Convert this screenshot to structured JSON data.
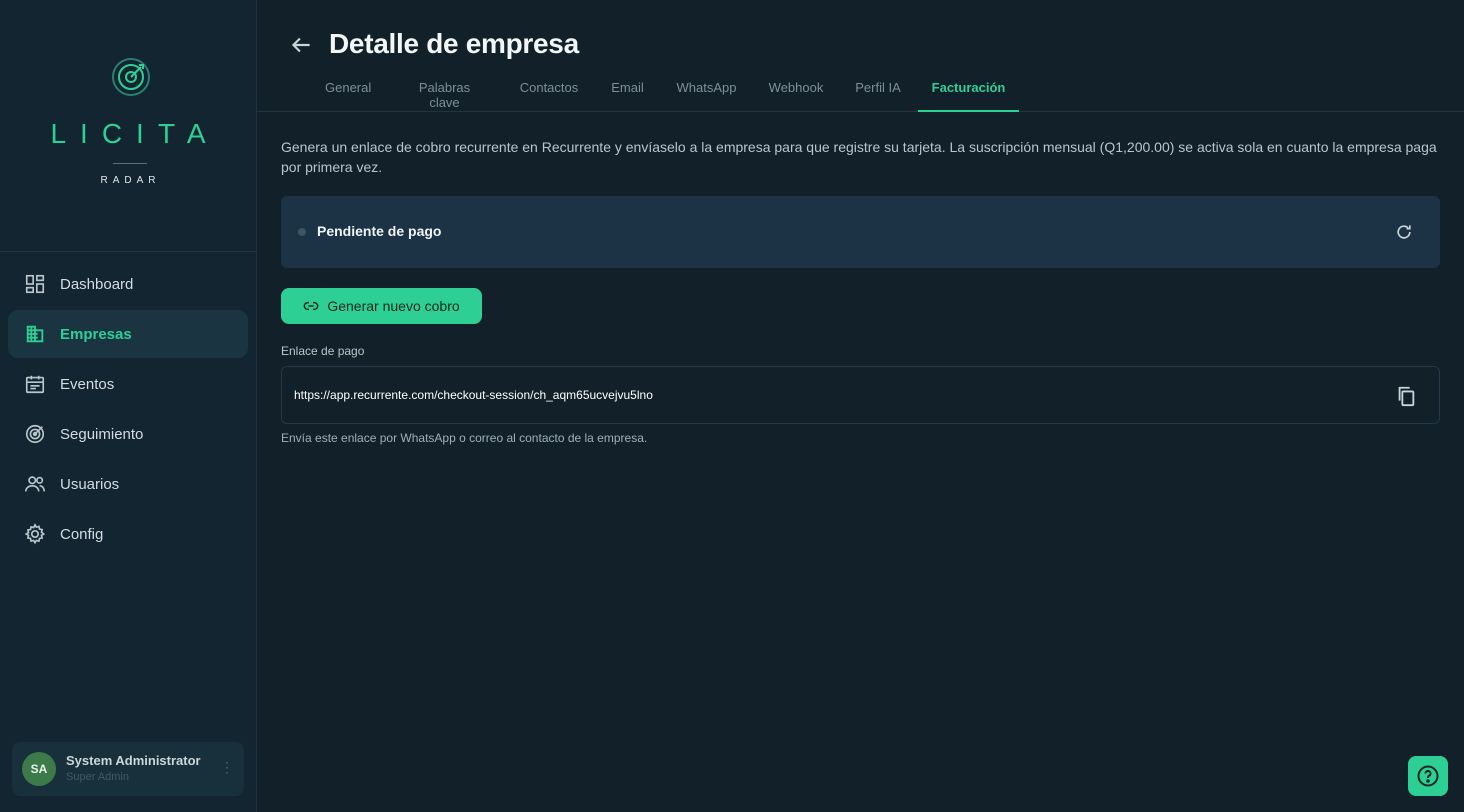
{
  "brand": {
    "name": "LICITA",
    "subtitle": "RADAR",
    "accent": "#2ecf94"
  },
  "sidebar": {
    "items": [
      {
        "label": "Dashboard",
        "icon": "dashboard-icon",
        "active": false
      },
      {
        "label": "Empresas",
        "icon": "building-icon",
        "active": true
      },
      {
        "label": "Eventos",
        "icon": "calendar-icon",
        "active": false
      },
      {
        "label": "Seguimiento",
        "icon": "radar-icon",
        "active": false
      },
      {
        "label": "Usuarios",
        "icon": "users-icon",
        "active": false
      },
      {
        "label": "Config",
        "icon": "gear-icon",
        "active": false
      }
    ],
    "user": {
      "initials": "SA",
      "name": "System Administrator",
      "role": "Super Admin"
    }
  },
  "header": {
    "title": "Detalle de empresa",
    "tabs": [
      {
        "label": "General"
      },
      {
        "label": "Palabras clave"
      },
      {
        "label": "Contactos"
      },
      {
        "label": "Email"
      },
      {
        "label": "WhatsApp"
      },
      {
        "label": "Webhook"
      },
      {
        "label": "Perfil IA"
      },
      {
        "label": "Facturación",
        "active": true
      }
    ]
  },
  "billing": {
    "intro": "Genera un enlace de cobro recurrente en Recurrente y envíaselo a la empresa para que registre su tarjeta. La suscripción mensual (Q1,200.00) se activa sola en cuanto la empresa paga por primera vez.",
    "status": "Pendiente de pago",
    "generate_label": "Generar nuevo cobro",
    "link_label": "Enlace de pago",
    "link_value": "https://app.recurrente.com/checkout-session/ch_aqm65ucvejvu5lno",
    "hint": "Envía este enlace por WhatsApp o correo al contacto de la empresa."
  }
}
